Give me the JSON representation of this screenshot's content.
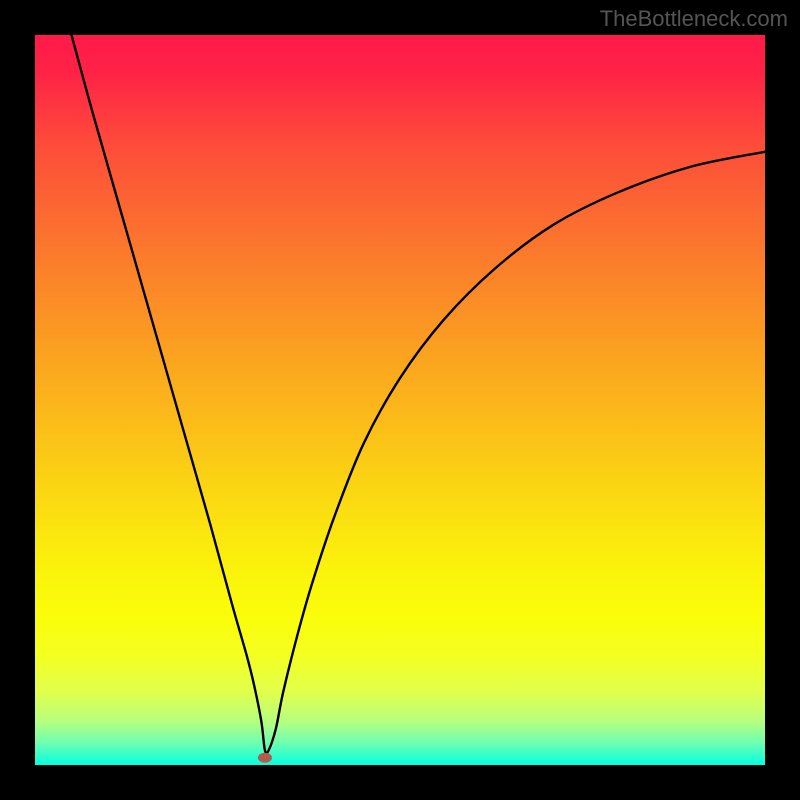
{
  "watermark": "TheBottleneck.com",
  "chart_data": {
    "type": "line",
    "title": "",
    "xlabel": "",
    "ylabel": "",
    "xlim": [
      0,
      100
    ],
    "ylim": [
      0,
      100
    ],
    "background_gradient": {
      "stops": [
        {
          "pos": 0.0,
          "color": "#ff1a49"
        },
        {
          "pos": 0.05,
          "color": "#ff2246"
        },
        {
          "pos": 0.15,
          "color": "#fd4c3a"
        },
        {
          "pos": 0.3,
          "color": "#fb7a2c"
        },
        {
          "pos": 0.45,
          "color": "#fba61f"
        },
        {
          "pos": 0.6,
          "color": "#fbd014"
        },
        {
          "pos": 0.72,
          "color": "#fbf00c"
        },
        {
          "pos": 0.8,
          "color": "#fafe0a"
        },
        {
          "pos": 0.85,
          "color": "#f4ff22"
        },
        {
          "pos": 0.9,
          "color": "#e1ff4c"
        },
        {
          "pos": 0.94,
          "color": "#b6ff7e"
        },
        {
          "pos": 0.97,
          "color": "#6effb3"
        },
        {
          "pos": 1.0,
          "color": "#04ffe0"
        }
      ]
    },
    "marker": {
      "x": 31.5,
      "y": 1.0,
      "color": "#b15c4c"
    },
    "series": [
      {
        "name": "curve",
        "x": [
          5,
          8,
          12,
          16,
          20,
          24,
          27,
          29,
          30,
          31,
          31.5,
          32,
          33,
          34,
          36,
          38,
          41,
          45,
          50,
          56,
          63,
          71,
          80,
          90,
          100
        ],
        "y": [
          100,
          89,
          75,
          61,
          47,
          33,
          22,
          15,
          11,
          6,
          2,
          2,
          5,
          10,
          18,
          25,
          34,
          44,
          53,
          61,
          68,
          74,
          78.5,
          82,
          84
        ]
      }
    ]
  }
}
